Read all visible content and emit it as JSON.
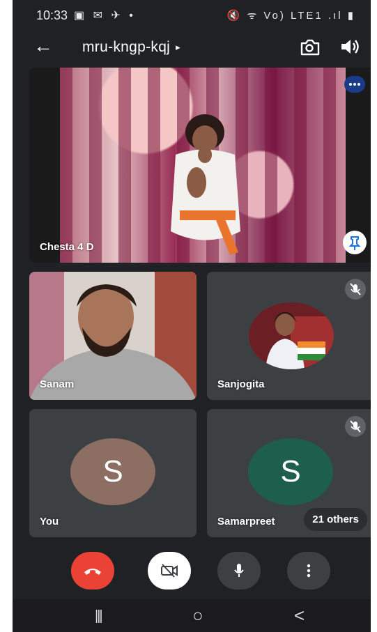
{
  "status": {
    "time": "10:33",
    "left_icons": "▣ ✉ ✈ •",
    "right_icons": "🔇 ᯤ Vo) LTE1 .ıl ▮"
  },
  "meeting": {
    "code": "mru-kngp-kqj",
    "dropdown_icon": "▸"
  },
  "participants": {
    "featured": {
      "name": "Chesta 4 D"
    },
    "tiles": [
      {
        "name": "Sanam"
      },
      {
        "name": "Sanjogita"
      },
      {
        "name": "You",
        "initial": "S",
        "avatar_color": "#8d6e63"
      },
      {
        "name": "Samarpreet",
        "initial": "S",
        "avatar_color": "#1e5f4b"
      }
    ],
    "others_label": "21 others"
  },
  "controls": {
    "end_color": "#ea4335",
    "mic_icon": "microphone-icon",
    "camera_icon": "camera-off-icon",
    "more_icon": "more-vertical-icon"
  },
  "nav": {
    "recents": "|||",
    "home": "○",
    "back": "<"
  }
}
